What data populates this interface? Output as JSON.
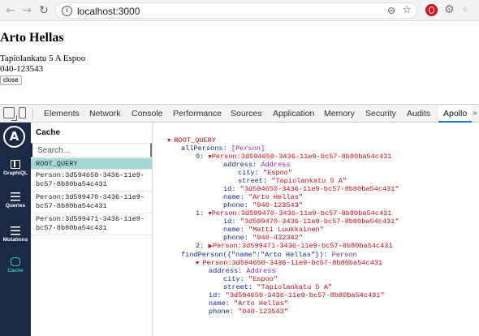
{
  "browser": {
    "url": "localhost:3000",
    "back_icon": "arrow-left-icon",
    "forward_icon": "arrow-right-icon",
    "reload_icon": "reload-icon"
  },
  "page": {
    "name": "Arto Hellas",
    "address": "Tapiolankatu 5 A Espoo",
    "phone": "040-123543",
    "close_label": "close"
  },
  "devtools": {
    "tabs": [
      "Elements",
      "Network",
      "Console",
      "Performance",
      "Sources",
      "Application",
      "Memory",
      "Security",
      "Audits",
      "Apollo"
    ],
    "active_tab": "Apollo",
    "accent_color": "#1a73e8"
  },
  "apollo": {
    "logo_letter": "A",
    "nav": [
      {
        "label": "GraphiQL",
        "icon": "graphiql-icon"
      },
      {
        "label": "Queries",
        "icon": "queries-icon"
      },
      {
        "label": "Mutations",
        "icon": "mutations-icon"
      },
      {
        "label": "Cache",
        "icon": "cache-icon",
        "active": true
      }
    ],
    "sidebar_color": "#1c2945",
    "active_color": "#3ac7c3"
  },
  "cache": {
    "title": "Cache",
    "search_placeholder": "Search...",
    "items": [
      "ROOT_QUERY",
      "Person:3d594650-3436-11e9-bc57-8b80ba54c431",
      "Person:3d599470-3436-11e9-bc57-8b80ba54c431",
      "Person:3d599471-3436-11e9-bc57-8b80ba54c431"
    ],
    "selected": "ROOT_QUERY"
  },
  "tree": {
    "root": "ROOT_QUERY",
    "allPersons_key": "allPersons:",
    "allPersons_type": "[Person]",
    "i0": "0:",
    "p0_ref": "Person:3d594650-3436-11e9-bc57-8b80ba54c431",
    "address_key": "address:",
    "address_type": "Address",
    "city_key": "city:",
    "city_val": "\"Espoo\"",
    "street_key": "street:",
    "street_val": "\"Tapiolankatu 5 A\"",
    "id_key": "id:",
    "p0_id": "\"3d594650-3436-11e9-bc57-8b80ba54c431\"",
    "name_key": "name:",
    "p0_name": "\"Arto Hellas\"",
    "phone_key": "phone:",
    "p0_phone": "\"040-123543\"",
    "i1": "1:",
    "p1_ref": "Person:3d599470-3436-11e9-bc57-8b80ba54c431",
    "p1_id": "\"3d599470-3436-11e9-bc57-8b80ba54c431\"",
    "p1_name": "\"Matti Luukkainen\"",
    "p1_phone": "\"040-432342\"",
    "i2": "2:",
    "p2_ref": "Person:3d599471-3436-11e9-bc57-8b80ba54c431",
    "find_key": "findPerson({\"name\":\"Arto Hellas\"}):",
    "find_type": "Person",
    "f_ref": "Person:3d594650-3436-11e9-bc57-8b80ba54c431",
    "f_city": "\"Espoo\"",
    "f_street": "\"Tapiolankatu 5 A\"",
    "f_id": "\"3d594650-3436-11e9-bc57-8b80ba54c431\"",
    "f_name": "\"Arto Hellas\"",
    "f_phone": "\"040-123543\""
  }
}
